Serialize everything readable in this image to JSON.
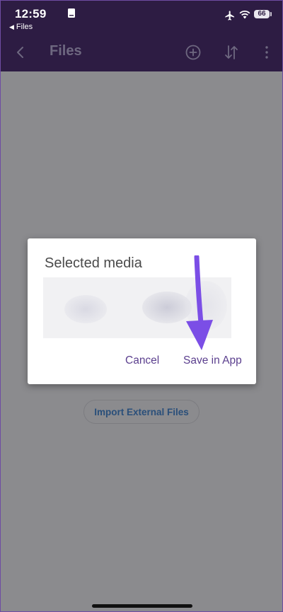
{
  "status_bar": {
    "time": "12:59",
    "back_to_app": "Files",
    "battery": "66",
    "icons": [
      "note-icon",
      "airplane-icon",
      "wifi-icon",
      "battery-icon"
    ]
  },
  "app_bar": {
    "title": "Files",
    "icons": [
      "back-chevron-icon",
      "add-circle-icon",
      "sort-icon",
      "more-vertical-icon"
    ]
  },
  "background": {
    "import_button_label": "Import External Files"
  },
  "dialog": {
    "title": "Selected media",
    "cancel_label": "Cancel",
    "save_label": "Save in App"
  },
  "colors": {
    "app_bar": "#2d1c43",
    "scrim": "#8b8b8e",
    "dialog_button_text": "#5b3f8e",
    "annotation_arrow": "#7b4ee6",
    "import_button_text": "#2a4f7a"
  }
}
